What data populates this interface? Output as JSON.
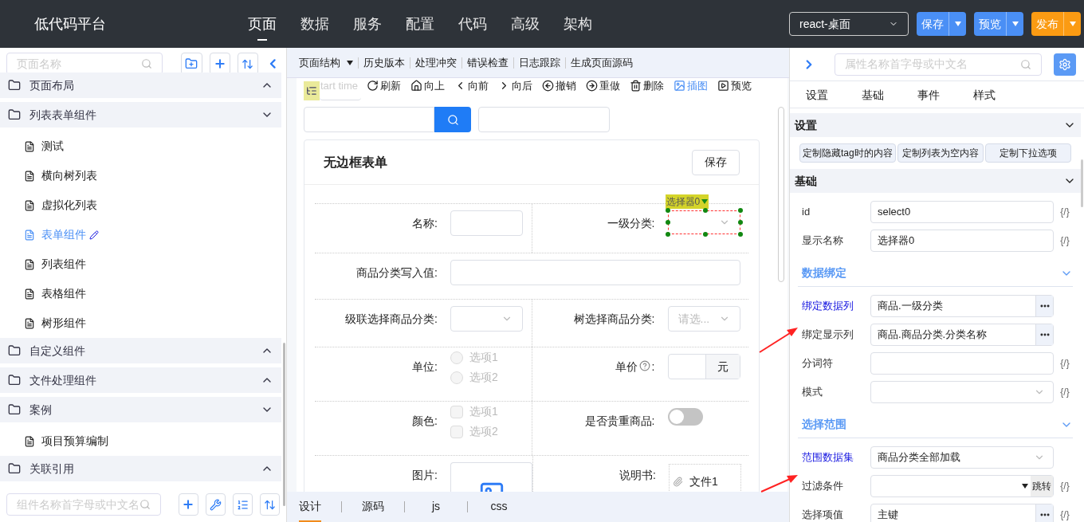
{
  "header": {
    "logo": "低代码平台",
    "nav": [
      {
        "label": "页面",
        "selected": true
      },
      {
        "label": "数据",
        "selected": false
      },
      {
        "label": "服务",
        "selected": false
      },
      {
        "label": "配置",
        "selected": false
      },
      {
        "label": "代码",
        "selected": false
      },
      {
        "label": "高级",
        "selected": false
      },
      {
        "label": "架构",
        "selected": false
      }
    ],
    "env_select": "react-桌面",
    "buttons": [
      {
        "label": "保存",
        "kind": "primary"
      },
      {
        "label": "预览",
        "kind": "primary"
      },
      {
        "label": "发布",
        "kind": "warning"
      }
    ]
  },
  "left": {
    "search_placeholder": "页面名称",
    "tree": [
      {
        "label": "页面布局",
        "expanded": false
      },
      {
        "label": "列表表单组件",
        "expanded": true,
        "children": [
          {
            "label": "测试",
            "selected": false
          },
          {
            "label": "横向树列表",
            "selected": false
          },
          {
            "label": "虚拟化列表",
            "selected": false
          },
          {
            "label": "表单组件",
            "selected": true
          },
          {
            "label": "列表组件",
            "selected": false
          },
          {
            "label": "表格组件",
            "selected": false
          },
          {
            "label": "树形组件",
            "selected": false
          }
        ]
      },
      {
        "label": "自定义组件",
        "expanded": false
      },
      {
        "label": "文件处理组件",
        "expanded": false
      },
      {
        "label": "案例",
        "expanded": true,
        "children": [
          {
            "label": "项目预算编制",
            "selected": false
          }
        ]
      },
      {
        "label": "关联引用",
        "expanded": false
      }
    ],
    "component_search_placeholder": "组件名称首字母或中文名"
  },
  "middle": {
    "menu": [
      {
        "label": "页面结构",
        "dropdown": true
      },
      {
        "label": "历史版本",
        "dropdown": false
      },
      {
        "label": "处理冲突",
        "dropdown": false
      },
      {
        "label": "错误检查",
        "dropdown": false
      },
      {
        "label": "日志跟踪",
        "dropdown": false
      },
      {
        "label": "生成页面源码",
        "dropdown": false
      }
    ],
    "actions": [
      {
        "label": "刷新",
        "kind": "refresh",
        "active": false
      },
      {
        "label": "向上",
        "kind": "up",
        "active": false
      },
      {
        "label": "向前",
        "kind": "back",
        "active": false
      },
      {
        "label": "向后",
        "kind": "forward",
        "active": false
      },
      {
        "label": "撤销",
        "kind": "undo",
        "active": false
      },
      {
        "label": "重做",
        "kind": "redo",
        "active": false
      },
      {
        "label": "删除",
        "kind": "delete",
        "active": false
      },
      {
        "label": "插图",
        "kind": "image",
        "active": true
      },
      {
        "label": "预览",
        "kind": "preview",
        "active": false
      }
    ],
    "date_placeholder": "tart time",
    "form": {
      "title": "无边框表单",
      "save": "保存",
      "selected_tag": "选择器0",
      "rows": [
        {
          "cells": [
            {
              "label": "名称:",
              "kind": "input"
            },
            {
              "label": "一级分类:",
              "kind": "select",
              "selected": true
            }
          ]
        },
        {
          "cells": [
            {
              "label": "商品分类写入值:",
              "kind": "input"
            }
          ]
        },
        {
          "cells": [
            {
              "label": "级联选择商品分类:",
              "kind": "select",
              "selected": false
            },
            {
              "label": "树选择商品分类:",
              "kind": "select",
              "selected": false,
              "placeholder": "请选..."
            }
          ]
        },
        {
          "cells": [
            {
              "label": "单位:",
              "kind": "radio",
              "options": [
                {
                  "label": "选项1",
                  "checked": false
                },
                {
                  "label": "选项2",
                  "checked": false
                }
              ]
            },
            {
              "label": "单价",
              "help": true,
              "colon": ":",
              "kind": "suffix",
              "suffix": "元"
            }
          ]
        },
        {
          "cells": [
            {
              "label": "颜色:",
              "kind": "checkbox",
              "options": [
                {
                  "label": "选项1",
                  "checked": false
                },
                {
                  "label": "选项2",
                  "checked": false
                }
              ]
            },
            {
              "label": "是否贵重商品:",
              "kind": "switch",
              "on": false
            }
          ]
        },
        {
          "cells": [
            {
              "label": "图片:",
              "kind": "image"
            },
            {
              "label": "说明书:",
              "kind": "file",
              "file": "文件1"
            }
          ]
        }
      ]
    },
    "tabs": [
      {
        "label": "设计",
        "selected": true
      },
      {
        "label": "源码",
        "selected": false
      },
      {
        "label": "js",
        "selected": false
      },
      {
        "label": "css",
        "selected": false
      }
    ]
  },
  "right": {
    "search_placeholder": "属性名称首字母或中文名",
    "tabs": [
      "设置",
      "基础",
      "事件",
      "样式"
    ],
    "sections": [
      {
        "title": "设置",
        "kind": "group",
        "buttons": [
          "定制隐藏tag时的内容",
          "定制列表为空内容",
          "定制下拉选项"
        ]
      },
      {
        "title": "基础",
        "kind": "group",
        "props": [
          {
            "label": "id",
            "value": "select0",
            "kind": "text",
            "highlighted": false,
            "expr": "{/}"
          },
          {
            "label": "显示名称",
            "value": "选择器0",
            "kind": "text",
            "highlighted": false,
            "expr": "{/}"
          }
        ]
      },
      {
        "title": "数据绑定",
        "kind": "sub",
        "props": [
          {
            "label": "绑定数据列",
            "value": "商品.一级分类",
            "kind": "picker",
            "highlighted": true
          },
          {
            "label": "绑定显示列",
            "value": "商品.商品分类.分类名称",
            "kind": "picker",
            "highlighted": false
          },
          {
            "label": "分词符",
            "kind": "text",
            "highlighted": false,
            "expr": "{/}"
          },
          {
            "label": "模式",
            "kind": "select",
            "highlighted": false,
            "expr": "{/}"
          }
        ]
      },
      {
        "title": "选择范围",
        "kind": "sub",
        "props": [
          {
            "label": "范围数据集",
            "value": "商品分类全部加载",
            "kind": "select",
            "highlighted": true
          },
          {
            "label": "过滤条件",
            "kind": "filter",
            "button": "跳转",
            "highlighted": false,
            "expr": "{/}"
          },
          {
            "label": "选择项值",
            "value": "主键",
            "kind": "picker",
            "highlighted": false,
            "expr": "{/}"
          }
        ]
      }
    ]
  }
}
